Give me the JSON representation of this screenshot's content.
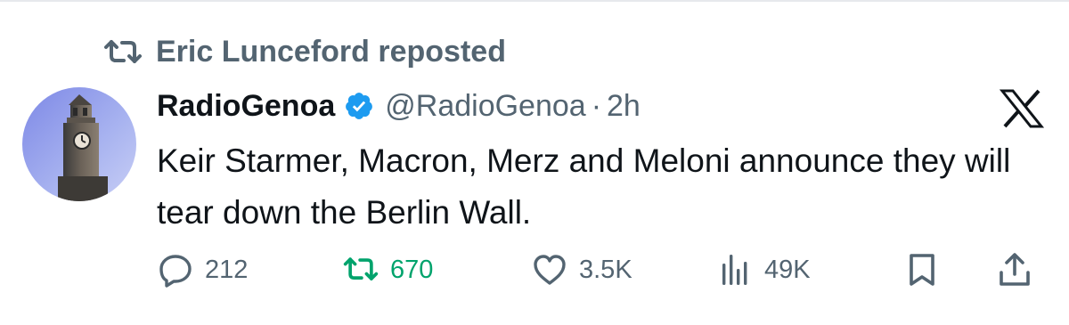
{
  "repost": {
    "icon": "repost-icon",
    "label": "Eric Lunceford reposted"
  },
  "author": {
    "display_name": "RadioGenoa",
    "verified": true,
    "verified_color": "#1d9bf0",
    "handle": "@RadioGenoa",
    "separator": "·",
    "time": "2h",
    "avatar": "clock-tower-avatar"
  },
  "platform_logo": "x-logo",
  "tweet": {
    "text": "Keir Starmer, Macron, Merz and Meloni announce they will tear down the Berlin Wall."
  },
  "actions": {
    "reply": {
      "icon": "reply-icon",
      "count": "212"
    },
    "repost": {
      "icon": "repost-icon",
      "count": "670",
      "active": true,
      "color": "#00a36c"
    },
    "like": {
      "icon": "heart-icon",
      "count": "3.5K"
    },
    "views": {
      "icon": "views-icon",
      "count": "49K"
    },
    "bookmark": {
      "icon": "bookmark-icon"
    },
    "share": {
      "icon": "share-icon"
    }
  },
  "colors": {
    "text_primary": "#0f1419",
    "text_secondary": "#536471",
    "accent_blue": "#1d9bf0",
    "repost_green": "#00a36c"
  }
}
